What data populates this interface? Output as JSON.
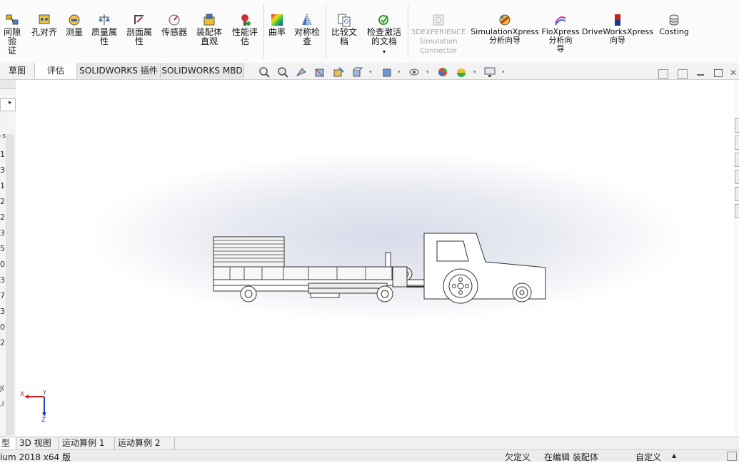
{
  "ribbon": {
    "buttons": [
      {
        "label": "间隙验\n证",
        "icon": "clearance-verification-icon"
      },
      {
        "label": "孔对齐",
        "icon": "hole-alignment-icon"
      },
      {
        "label": "测量",
        "icon": "measure-icon"
      },
      {
        "label": "质量属\n性",
        "icon": "mass-properties-icon"
      },
      {
        "label": "剖面属\n性",
        "icon": "section-properties-icon"
      },
      {
        "label": "传感器",
        "icon": "sensor-icon"
      },
      {
        "label": "装配体\n直观",
        "icon": "assemblyxpert-icon"
      },
      {
        "label": "性能评\n估",
        "icon": "performance-evaluation-icon"
      },
      {
        "label": "曲率",
        "icon": "curvature-icon"
      },
      {
        "label": "对称检\n查",
        "icon": "symmetry-check-icon"
      },
      {
        "label": "比较文\n档",
        "icon": "compare-documents-icon"
      },
      {
        "label": "检查激活\n的文档",
        "icon": "check-active-document-icon"
      },
      {
        "label": "3DEXPERIENCE\nSimulation\nConnector",
        "icon": "3dexperience-icon"
      },
      {
        "label": "SimulationXpress\n分析向导",
        "icon": "simulationxpress-icon"
      },
      {
        "label": "FloXpress\n分析向\n导",
        "icon": "floxpress-icon"
      },
      {
        "label": "DriveWorksXpress\n向导",
        "icon": "driveworksxpress-icon"
      },
      {
        "label": "Costing",
        "icon": "costing-icon"
      }
    ],
    "dropdown_glyph": "▾"
  },
  "tabs": [
    "草图",
    "评估",
    "SOLIDWORKS 插件",
    "SOLIDWORKS MBD"
  ],
  "left_panel": {
    "arrow": "▸",
    "values": [
      "1",
      "3",
      "1",
      "2",
      "2",
      "3",
      "5",
      "0",
      "3",
      "7",
      "3",
      "0",
      "2"
    ],
    "partial": [
      "-s",
      "J(",
      ",l"
    ]
  },
  "triad": {
    "x": "X",
    "y": "Y",
    "z": "Z"
  },
  "bottom_tabs": [
    "型",
    "3D 视图",
    "运动算例 1",
    "运动算例 2"
  ],
  "status": {
    "app": "ium 2018 x64 版",
    "underdefined": "欠定义",
    "editing": "在编辑 装配体",
    "custom": "自定义",
    "up": "▲"
  },
  "colors": {
    "accent": "#3366cc",
    "triad_x": "#d02020",
    "triad_z": "#2040c0"
  }
}
